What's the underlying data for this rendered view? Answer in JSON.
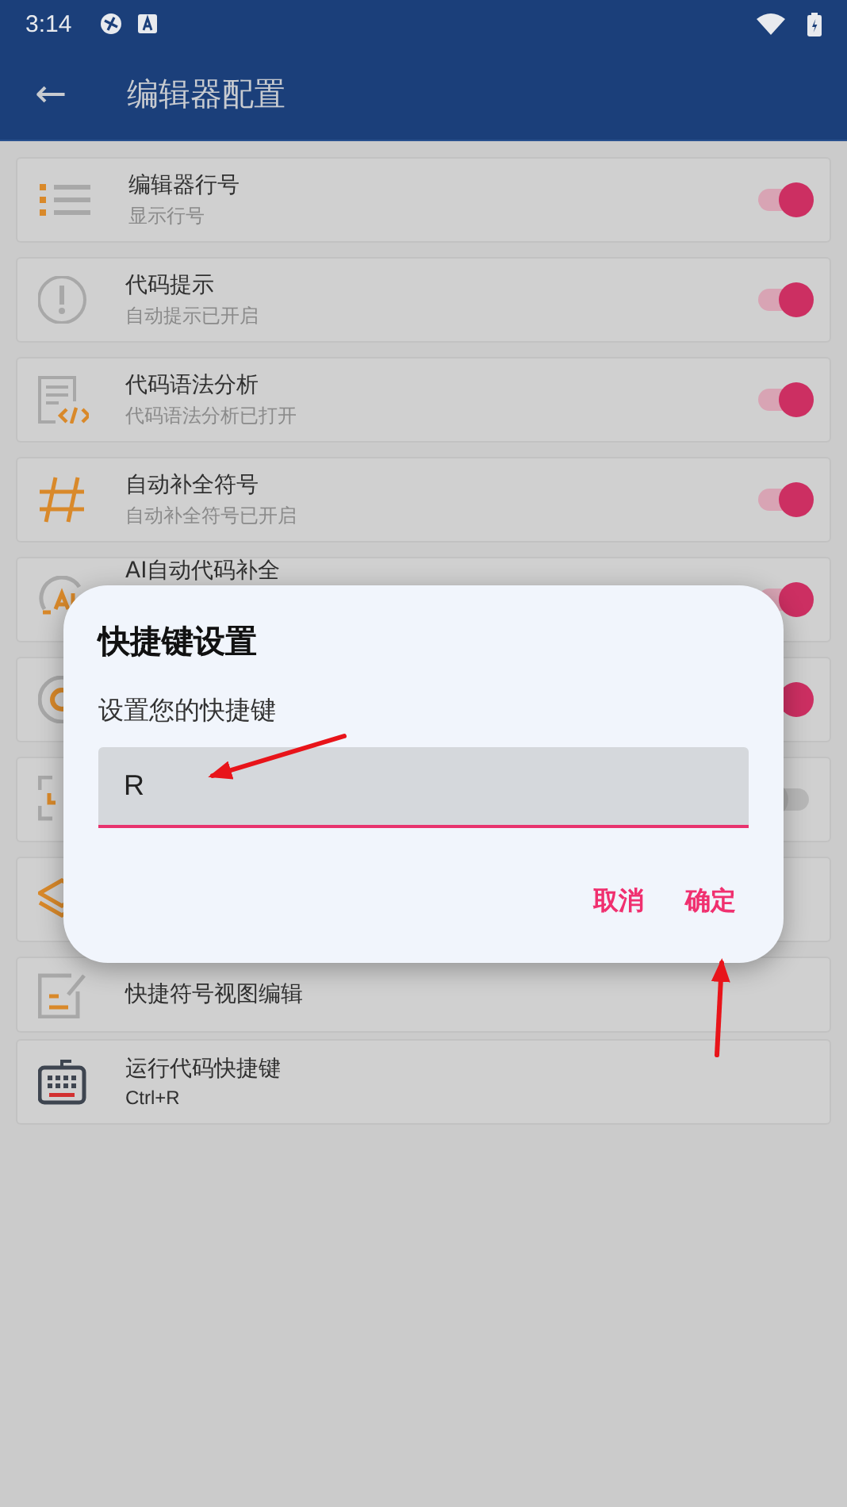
{
  "status_bar": {
    "time": "3:14"
  },
  "app_bar": {
    "back": "←",
    "title": "编辑器配置"
  },
  "settings": [
    {
      "kind": "switch",
      "title": "编辑器行号",
      "subtitle": "显示行号",
      "on": true
    },
    {
      "kind": "switch",
      "title": "代码提示",
      "subtitle": "自动提示已开启",
      "on": true
    },
    {
      "kind": "switch",
      "title": "代码语法分析",
      "subtitle": "代码语法分析已打开",
      "on": true
    },
    {
      "kind": "switch",
      "title": "自动补全符号",
      "subtitle": "自动补全符号已开启",
      "on": true
    },
    {
      "kind": "switch",
      "title": "AI自动代码补全",
      "on": true
    },
    {
      "kind": "switch",
      "on": true
    },
    {
      "kind": "switch",
      "on": false
    },
    {
      "kind": "plain"
    },
    {
      "kind": "plain",
      "title": "快捷符号视图编辑"
    },
    {
      "kind": "plain",
      "title": "运行代码快捷键",
      "subtitle": "Ctrl+R"
    }
  ],
  "dialog": {
    "title": "快捷键设置",
    "label": "设置您的快捷键",
    "value": "R",
    "buttons": [
      "取消",
      "确定"
    ]
  }
}
